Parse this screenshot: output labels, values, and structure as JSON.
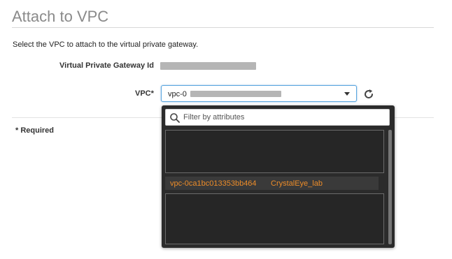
{
  "page": {
    "title": "Attach to VPC",
    "description": "Select the VPC to attach to the virtual private gateway."
  },
  "form": {
    "vpg_label": "Virtual Private Gateway Id",
    "vpc_label": "VPC*",
    "vpc_value_prefix": "vpc-0",
    "required_note": "* Required"
  },
  "dropdown": {
    "filter_placeholder": "Filter by attributes",
    "options": [
      {
        "id": "vpc-0ca1bc013353bb464",
        "name": "CrystalEye_lab"
      }
    ]
  },
  "colors": {
    "accent_orange": "#ec8c29",
    "focus_blue": "#5aa6e0",
    "dropdown_bg": "#2b2b2b"
  },
  "icons": {
    "refresh": "refresh-icon",
    "search": "search-icon",
    "caret": "chevron-down-icon"
  }
}
